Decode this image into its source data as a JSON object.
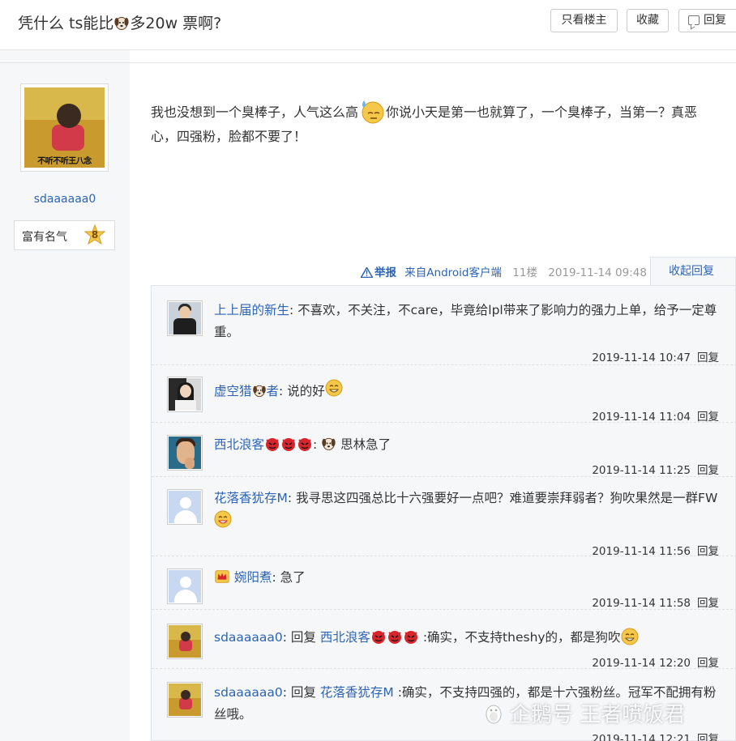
{
  "header": {
    "title_before": "凭什么 ts能比",
    "title_after": "多20w 票啊?",
    "title_emoji": "dog-emoji",
    "buttons": {
      "only_author": "只看楼主",
      "favorite": "收藏",
      "reply": "回复"
    }
  },
  "author": {
    "avatar_caption": "不听不听王八念",
    "name": "sdaaaaaa0",
    "fame_label": "富有名气",
    "fame_level": "8"
  },
  "post": {
    "text_part1": "我也没想到一个臭棒子，人气这么高",
    "emoji": "sweat-emoji",
    "text_part2": "你说小天是第一也就算了，一个臭棒子，当第一？真恶心，四强粉，脸都不要了！",
    "meta": {
      "report": "举报",
      "client": "来自Android客户端",
      "floor": "11楼",
      "time": "2019-11-14 09:48",
      "collapse": "收起回复"
    }
  },
  "replies": [
    {
      "user": "上上届的新生",
      "text": "不喜欢，不关注，不care，毕竟给lpl带来了影响力的强力上单，给予一定尊重。",
      "time": "2019-11-14 10:47",
      "reply_label": "回复"
    },
    {
      "user_a": "虚空猎",
      "user_b": "者",
      "text": "说的好",
      "time": "2019-11-14 11:04",
      "reply_label": "回复"
    },
    {
      "user": "西北浪客",
      "text": "思林急了",
      "time": "2019-11-14 11:25",
      "reply_label": "回复"
    },
    {
      "user": "花落香犹存M",
      "text": "我寻思这四强总比十六强要好一点吧？难道要崇拜弱者？狗吹果然是一群FW",
      "time": "2019-11-14 11:56",
      "reply_label": "回复"
    },
    {
      "user": "婉阳煮",
      "text": "急了",
      "time": "2019-11-14 11:58",
      "reply_label": "回复"
    },
    {
      "user": "sdaaaaaa0",
      "reply_word": "回复",
      "target": "西北浪客",
      "text": ":确实，不支持theshy的，都是狗吹",
      "time": "2019-11-14 12:20",
      "reply_label": "回复"
    },
    {
      "user": "sdaaaaaa0",
      "reply_word": "回复",
      "target": "花落香犹存M",
      "text": ":确实，不支持四强的，都是十六强粉丝。冠军不配拥有粉丝哦。",
      "time": "2019-11-14 12:21",
      "reply_label": "回复"
    }
  ],
  "watermark": "企鹅号 王者喷饭君",
  "colors": {
    "link": "#2d64b3",
    "panel_bg": "#f6f7f9"
  }
}
